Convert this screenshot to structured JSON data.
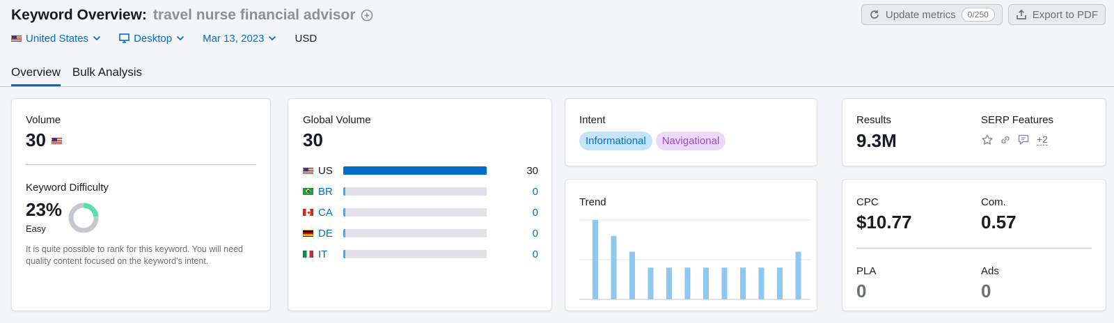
{
  "header": {
    "title": "Keyword Overview:",
    "keyword": "travel nurse financial advisor",
    "update_label": "Update metrics",
    "update_count": "0/250",
    "export_label": "Export to PDF"
  },
  "filters": {
    "country": "United States",
    "device": "Desktop",
    "date": "Mar 13, 2023",
    "currency": "USD"
  },
  "tabs": [
    {
      "label": "Overview",
      "active": true
    },
    {
      "label": "Bulk Analysis",
      "active": false
    }
  ],
  "volume": {
    "label": "Volume",
    "value": "30",
    "flag": "us"
  },
  "keyword_difficulty": {
    "label": "Keyword Difficulty",
    "value": "23%",
    "percent": 23,
    "level": "Easy",
    "description": "It is quite possible to rank for this keyword. You will need quality content focused on the keyword's intent.",
    "color": "#59ddaa",
    "track_color": "#c4c7cf"
  },
  "global_volume": {
    "label": "Global Volume",
    "value": "30",
    "countries": [
      {
        "code": "US",
        "flag": "us",
        "value": "30",
        "fraction": 1.0
      },
      {
        "code": "BR",
        "flag": "br",
        "value": "0",
        "fraction": 0.0
      },
      {
        "code": "CA",
        "flag": "ca",
        "value": "0",
        "fraction": 0.0
      },
      {
        "code": "DE",
        "flag": "de",
        "value": "0",
        "fraction": 0.0
      },
      {
        "code": "IT",
        "flag": "it",
        "value": "0",
        "fraction": 0.0
      }
    ]
  },
  "intent": {
    "label": "Intent",
    "tags": [
      "Informational",
      "Navigational"
    ]
  },
  "trend": {
    "label": "Trend",
    "bar_color": "#8ec8f1",
    "values": [
      1.0,
      0.8,
      0.6,
      0.4,
      0.4,
      0.4,
      0.4,
      0.4,
      0.4,
      0.4,
      0.4,
      0.6
    ]
  },
  "results": {
    "label": "Results",
    "value": "9.3M"
  },
  "serp_features": {
    "label": "SERP Features",
    "icons": [
      "star-icon",
      "link-icon",
      "review-icon"
    ],
    "more": "+2"
  },
  "cpc": {
    "label": "CPC",
    "value": "$10.77"
  },
  "competition": {
    "label": "Com.",
    "value": "0.57"
  },
  "pla": {
    "label": "PLA",
    "value": "0"
  },
  "ads": {
    "label": "Ads",
    "value": "0"
  }
}
